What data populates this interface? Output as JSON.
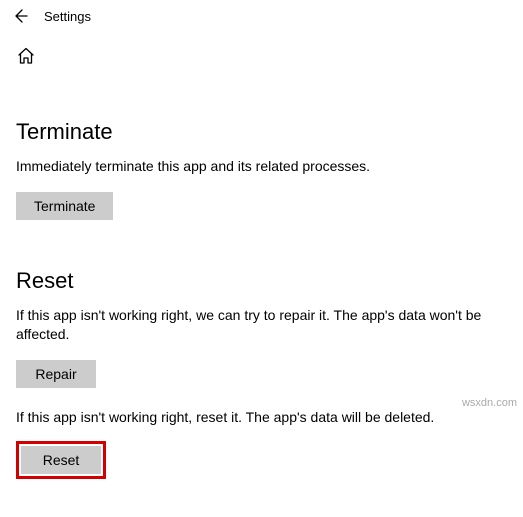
{
  "header": {
    "title": "Settings"
  },
  "terminate": {
    "heading": "Terminate",
    "desc": "Immediately terminate this app and its related processes.",
    "button": "Terminate"
  },
  "reset": {
    "heading": "Reset",
    "repair_desc": "If this app isn't working right, we can try to repair it. The app's data won't be affected.",
    "repair_button": "Repair",
    "reset_desc": "If this app isn't working right, reset it. The app's data will be deleted.",
    "reset_button": "Reset"
  },
  "watermark": "wsxdn.com"
}
